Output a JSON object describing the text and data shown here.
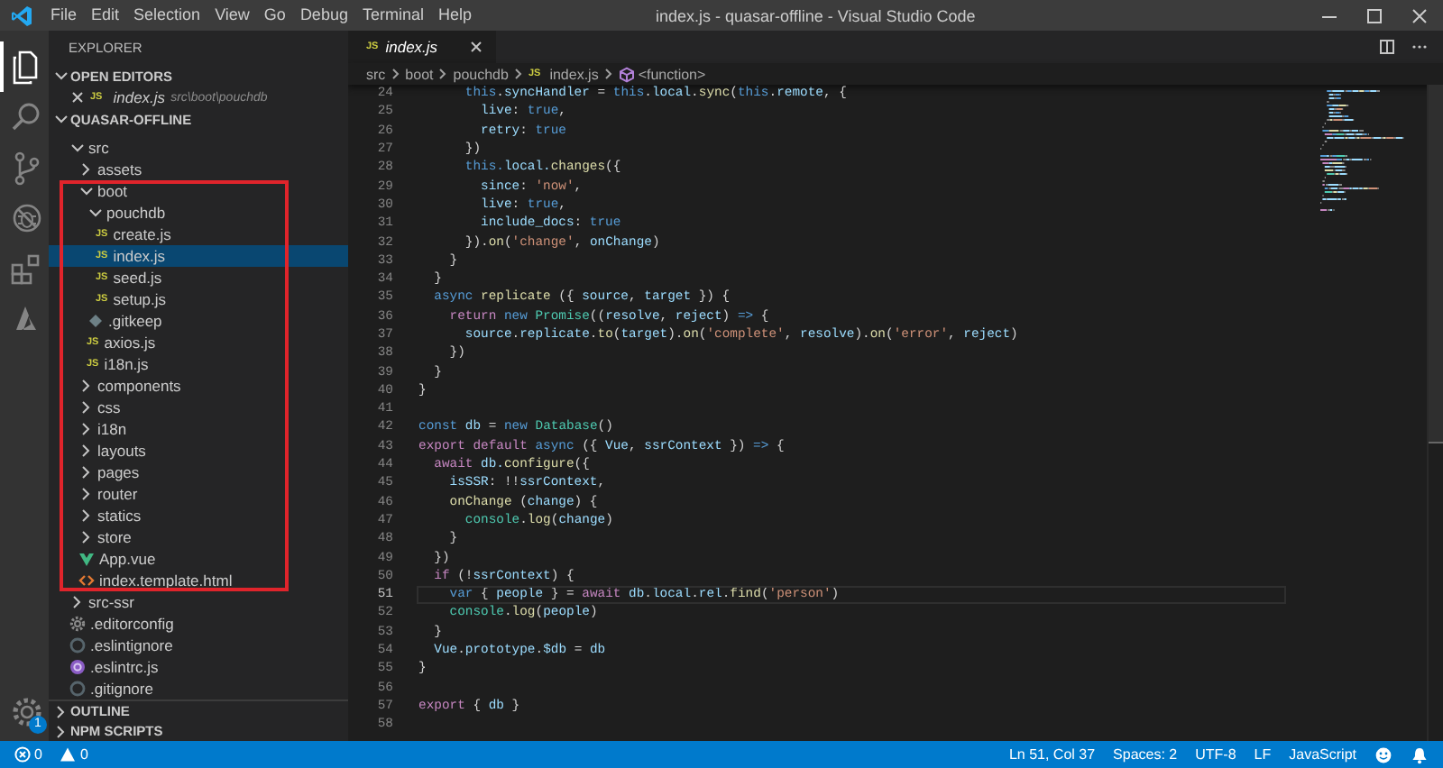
{
  "window": {
    "title": "index.js - quasar-offline - Visual Studio Code"
  },
  "menu": [
    "File",
    "Edit",
    "Selection",
    "View",
    "Go",
    "Debug",
    "Terminal",
    "Help"
  ],
  "activity_bar": {
    "items": [
      {
        "kind": "files",
        "selected": true
      },
      {
        "kind": "search",
        "selected": false
      },
      {
        "kind": "source-control",
        "selected": false
      },
      {
        "kind": "debug",
        "selected": false
      },
      {
        "kind": "extensions",
        "selected": false
      },
      {
        "kind": "azure",
        "selected": false
      }
    ],
    "settings_badge": "1"
  },
  "sidebar": {
    "title": "EXPLORER",
    "open_editors": {
      "title": "OPEN EDITORS",
      "expanded": true,
      "items": [
        {
          "badge": "JS",
          "name": "index.js",
          "path": "src\\boot\\pouchdb"
        }
      ]
    },
    "folder": {
      "title": "QUASAR-OFFLINE",
      "expanded": true
    },
    "tree": [
      {
        "label": "src",
        "kind": "folder",
        "expanded": true,
        "selected": false,
        "framed": false,
        "children": [
          {
            "label": "assets",
            "kind": "folder",
            "expanded": false,
            "selected": false,
            "framed": false
          },
          {
            "label": "boot",
            "kind": "folder",
            "expanded": true,
            "selected": false,
            "framed": true,
            "children": [
              {
                "label": "pouchdb",
                "kind": "folder",
                "expanded": true,
                "selected": false,
                "framed": true,
                "children": [
                  {
                    "label": "create.js",
                    "kind": "js",
                    "badge": "JS",
                    "selected": false,
                    "framed": true
                  },
                  {
                    "label": "index.js",
                    "kind": "js",
                    "badge": "JS",
                    "selected": true,
                    "framed": true
                  },
                  {
                    "label": "seed.js",
                    "kind": "js",
                    "badge": "JS",
                    "selected": false,
                    "framed": true
                  },
                  {
                    "label": "setup.js",
                    "kind": "js",
                    "badge": "JS",
                    "selected": false,
                    "framed": true
                  }
                ]
              },
              {
                "label": ".gitkeep",
                "kind": "gitkeep",
                "selected": false,
                "framed": true
              },
              {
                "label": "axios.js",
                "kind": "js",
                "badge": "JS",
                "selected": false,
                "framed": true
              },
              {
                "label": "i18n.js",
                "kind": "js",
                "badge": "JS",
                "selected": false,
                "framed": true
              }
            ]
          },
          {
            "label": "components",
            "kind": "folder",
            "expanded": false,
            "selected": false,
            "framed": true
          },
          {
            "label": "css",
            "kind": "folder",
            "expanded": false,
            "selected": false,
            "framed": true
          },
          {
            "label": "i18n",
            "kind": "folder",
            "expanded": false,
            "selected": false,
            "framed": true
          },
          {
            "label": "layouts",
            "kind": "folder",
            "expanded": false,
            "selected": false,
            "framed": true
          },
          {
            "label": "pages",
            "kind": "folder",
            "expanded": false,
            "selected": false,
            "framed": true
          },
          {
            "label": "router",
            "kind": "folder",
            "expanded": false,
            "selected": false,
            "framed": true
          },
          {
            "label": "statics",
            "kind": "folder",
            "expanded": false,
            "selected": false,
            "framed": true
          },
          {
            "label": "store",
            "kind": "folder",
            "expanded": false,
            "selected": false,
            "framed": true
          },
          {
            "label": "App.vue",
            "kind": "vue",
            "selected": false,
            "framed": true
          },
          {
            "label": "index.template.html",
            "kind": "html",
            "selected": false,
            "framed": true
          }
        ]
      },
      {
        "label": "src-ssr",
        "kind": "folder",
        "expanded": false,
        "selected": false,
        "framed": false
      },
      {
        "label": ".editorconfig",
        "kind": "config",
        "selected": false,
        "framed": false
      },
      {
        "label": ".eslintignore",
        "kind": "ignore",
        "selected": false,
        "framed": false
      },
      {
        "label": ".eslintrc.js",
        "kind": "eslint",
        "selected": false,
        "framed": false
      },
      {
        "label": ".gitignore",
        "kind": "ignore",
        "selected": false,
        "framed": false
      }
    ],
    "panels": [
      {
        "title": "OUTLINE",
        "expanded": false
      },
      {
        "title": "NPM SCRIPTS",
        "expanded": false
      }
    ]
  },
  "tabs": [
    {
      "badge": "JS",
      "label": "index.js",
      "selected": true
    }
  ],
  "breadcrumb": [
    {
      "text": "src"
    },
    {
      "text": "boot"
    },
    {
      "text": "pouchdb"
    },
    {
      "text": "index.js",
      "badge": "JS"
    },
    {
      "text": "<function>",
      "kind": "symbol"
    }
  ],
  "code": [
    {
      "number": "24",
      "current": false,
      "tokens": [
        {
          "kind": "keyword",
          "text": "      this"
        },
        {
          "kind": "plain",
          "text": "."
        },
        {
          "kind": "variable",
          "text": "syncHandler"
        },
        {
          "kind": "plain",
          "text": " = "
        },
        {
          "kind": "keyword",
          "text": "this"
        },
        {
          "kind": "plain",
          "text": "."
        },
        {
          "kind": "variable",
          "text": "local"
        },
        {
          "kind": "plain",
          "text": "."
        },
        {
          "kind": "function",
          "text": "sync"
        },
        {
          "kind": "plain",
          "text": "("
        },
        {
          "kind": "keyword",
          "text": "this"
        },
        {
          "kind": "plain",
          "text": "."
        },
        {
          "kind": "variable",
          "text": "remote"
        },
        {
          "kind": "plain",
          "text": ", {"
        }
      ]
    },
    {
      "number": "25",
      "current": false,
      "tokens": [
        {
          "kind": "variable",
          "text": "        live"
        },
        {
          "kind": "plain",
          "text": ": "
        },
        {
          "kind": "keyword",
          "text": "true"
        },
        {
          "kind": "plain",
          "text": ","
        }
      ]
    },
    {
      "number": "26",
      "current": false,
      "tokens": [
        {
          "kind": "variable",
          "text": "        retry"
        },
        {
          "kind": "plain",
          "text": ": "
        },
        {
          "kind": "keyword",
          "text": "true"
        }
      ]
    },
    {
      "number": "27",
      "current": false,
      "tokens": [
        {
          "kind": "plain",
          "text": "      })"
        }
      ]
    },
    {
      "number": "28",
      "current": false,
      "tokens": [
        {
          "kind": "keyword",
          "text": "      this."
        },
        {
          "kind": "variable",
          "text": "local."
        },
        {
          "kind": "function",
          "text": "changes"
        },
        {
          "kind": "plain",
          "text": "({"
        }
      ]
    },
    {
      "number": "29",
      "current": false,
      "tokens": [
        {
          "kind": "variable",
          "text": "        since"
        },
        {
          "kind": "plain",
          "text": ": "
        },
        {
          "kind": "string",
          "text": "'now'"
        },
        {
          "kind": "plain",
          "text": ","
        }
      ]
    },
    {
      "number": "30",
      "current": false,
      "tokens": [
        {
          "kind": "variable",
          "text": "        live"
        },
        {
          "kind": "plain",
          "text": ": "
        },
        {
          "kind": "keyword",
          "text": "true"
        },
        {
          "kind": "plain",
          "text": ","
        }
      ]
    },
    {
      "number": "31",
      "current": false,
      "tokens": [
        {
          "kind": "variable",
          "text": "        include_docs"
        },
        {
          "kind": "plain",
          "text": ": "
        },
        {
          "kind": "keyword",
          "text": "true"
        }
      ]
    },
    {
      "number": "32",
      "current": false,
      "tokens": [
        {
          "kind": "plain",
          "text": "      })."
        },
        {
          "kind": "function",
          "text": "on"
        },
        {
          "kind": "plain",
          "text": "("
        },
        {
          "kind": "string",
          "text": "'change'"
        },
        {
          "kind": "plain",
          "text": ", "
        },
        {
          "kind": "variable",
          "text": "onChange"
        },
        {
          "kind": "plain",
          "text": ")"
        }
      ]
    },
    {
      "number": "33",
      "current": false,
      "tokens": [
        {
          "kind": "plain",
          "text": "    }"
        }
      ]
    },
    {
      "number": "34",
      "current": false,
      "tokens": [
        {
          "kind": "plain",
          "text": "  }"
        }
      ]
    },
    {
      "number": "35",
      "current": false,
      "tokens": [
        {
          "kind": "keyword",
          "text": "  async "
        },
        {
          "kind": "function",
          "text": "replicate"
        },
        {
          "kind": "plain",
          "text": " ({ "
        },
        {
          "kind": "variable",
          "text": "source"
        },
        {
          "kind": "plain",
          "text": ", "
        },
        {
          "kind": "variable",
          "text": "target"
        },
        {
          "kind": "plain",
          "text": " }) {"
        }
      ]
    },
    {
      "number": "36",
      "current": false,
      "tokens": [
        {
          "kind": "control",
          "text": "    return "
        },
        {
          "kind": "keyword",
          "text": "new "
        },
        {
          "kind": "type",
          "text": "Promise"
        },
        {
          "kind": "plain",
          "text": "(("
        },
        {
          "kind": "variable",
          "text": "resolve"
        },
        {
          "kind": "plain",
          "text": ", "
        },
        {
          "kind": "variable",
          "text": "reject"
        },
        {
          "kind": "plain",
          "text": ") "
        },
        {
          "kind": "keyword",
          "text": "=>"
        },
        {
          "kind": "plain",
          "text": " {"
        }
      ]
    },
    {
      "number": "37",
      "current": false,
      "tokens": [
        {
          "kind": "variable",
          "text": "      source"
        },
        {
          "kind": "plain",
          "text": "."
        },
        {
          "kind": "variable",
          "text": "replicate"
        },
        {
          "kind": "plain",
          "text": "."
        },
        {
          "kind": "function",
          "text": "to"
        },
        {
          "kind": "plain",
          "text": "("
        },
        {
          "kind": "variable",
          "text": "target"
        },
        {
          "kind": "plain",
          "text": ")."
        },
        {
          "kind": "function",
          "text": "on"
        },
        {
          "kind": "plain",
          "text": "("
        },
        {
          "kind": "string",
          "text": "'complete'"
        },
        {
          "kind": "plain",
          "text": ", "
        },
        {
          "kind": "variable",
          "text": "resolve"
        },
        {
          "kind": "plain",
          "text": ")."
        },
        {
          "kind": "function",
          "text": "on"
        },
        {
          "kind": "plain",
          "text": "("
        },
        {
          "kind": "string",
          "text": "'error'"
        },
        {
          "kind": "plain",
          "text": ", "
        },
        {
          "kind": "variable",
          "text": "reject"
        },
        {
          "kind": "plain",
          "text": ")"
        }
      ]
    },
    {
      "number": "38",
      "current": false,
      "tokens": [
        {
          "kind": "plain",
          "text": "    })"
        }
      ]
    },
    {
      "number": "39",
      "current": false,
      "tokens": [
        {
          "kind": "plain",
          "text": "  }"
        }
      ]
    },
    {
      "number": "40",
      "current": false,
      "tokens": [
        {
          "kind": "plain",
          "text": "}"
        }
      ]
    },
    {
      "number": "41",
      "current": false
    },
    {
      "number": "42",
      "current": false,
      "tokens": [
        {
          "kind": "keyword",
          "text": "const "
        },
        {
          "kind": "variable",
          "text": "db"
        },
        {
          "kind": "plain",
          "text": " = "
        },
        {
          "kind": "keyword",
          "text": "new "
        },
        {
          "kind": "type",
          "text": "Database"
        },
        {
          "kind": "plain",
          "text": "()"
        }
      ]
    },
    {
      "number": "43",
      "current": false,
      "tokens": [
        {
          "kind": "control",
          "text": "export default "
        },
        {
          "kind": "keyword",
          "text": "async"
        },
        {
          "kind": "plain",
          "text": " ({ "
        },
        {
          "kind": "variable",
          "text": "Vue"
        },
        {
          "kind": "plain",
          "text": ", "
        },
        {
          "kind": "variable",
          "text": "ssrContext"
        },
        {
          "kind": "plain",
          "text": " }) "
        },
        {
          "kind": "keyword",
          "text": "=>"
        },
        {
          "kind": "plain",
          "text": " {"
        }
      ]
    },
    {
      "number": "44",
      "current": false,
      "tokens": [
        {
          "kind": "control",
          "text": "  await "
        },
        {
          "kind": "variable",
          "text": "db."
        },
        {
          "kind": "function",
          "text": "configure"
        },
        {
          "kind": "plain",
          "text": "({"
        }
      ]
    },
    {
      "number": "45",
      "current": false,
      "tokens": [
        {
          "kind": "variable",
          "text": "    isSSR"
        },
        {
          "kind": "plain",
          "text": ": !!"
        },
        {
          "kind": "variable",
          "text": "ssrContext"
        },
        {
          "kind": "plain",
          "text": ","
        }
      ]
    },
    {
      "number": "46",
      "current": false,
      "tokens": [
        {
          "kind": "function",
          "text": "    onChange"
        },
        {
          "kind": "plain",
          "text": " ("
        },
        {
          "kind": "variable",
          "text": "change"
        },
        {
          "kind": "plain",
          "text": ") {"
        }
      ]
    },
    {
      "number": "47",
      "current": false,
      "tokens": [
        {
          "kind": "type",
          "text": "      console"
        },
        {
          "kind": "plain",
          "text": "."
        },
        {
          "kind": "function",
          "text": "log"
        },
        {
          "kind": "plain",
          "text": "("
        },
        {
          "kind": "variable",
          "text": "change"
        },
        {
          "kind": "plain",
          "text": ")"
        }
      ]
    },
    {
      "number": "48",
      "current": false,
      "tokens": [
        {
          "kind": "plain",
          "text": "    }"
        }
      ]
    },
    {
      "number": "49",
      "current": false,
      "tokens": [
        {
          "kind": "plain",
          "text": "  })"
        }
      ]
    },
    {
      "number": "50",
      "current": false,
      "tokens": [
        {
          "kind": "control",
          "text": "  if"
        },
        {
          "kind": "plain",
          "text": " (!"
        },
        {
          "kind": "variable",
          "text": "ssrContext"
        },
        {
          "kind": "plain",
          "text": ") {"
        }
      ]
    },
    {
      "number": "51",
      "current": true,
      "tokens": [
        {
          "kind": "keyword",
          "text": "    var"
        },
        {
          "kind": "plain",
          "text": " { "
        },
        {
          "kind": "variable",
          "text": "people"
        },
        {
          "kind": "plain",
          "text": " } = "
        },
        {
          "kind": "control",
          "text": "await "
        },
        {
          "kind": "variable",
          "text": "db"
        },
        {
          "kind": "plain",
          "text": "."
        },
        {
          "kind": "variable",
          "text": "local"
        },
        {
          "kind": "plain",
          "text": "."
        },
        {
          "kind": "variable",
          "text": "rel"
        },
        {
          "kind": "plain",
          "text": "."
        },
        {
          "kind": "function",
          "text": "find"
        },
        {
          "kind": "plain",
          "text": "("
        },
        {
          "kind": "string",
          "text": "'person'"
        },
        {
          "kind": "plain",
          "text": ")"
        }
      ]
    },
    {
      "number": "52",
      "current": false,
      "tokens": [
        {
          "kind": "type",
          "text": "    console"
        },
        {
          "kind": "plain",
          "text": "."
        },
        {
          "kind": "function",
          "text": "log"
        },
        {
          "kind": "plain",
          "text": "("
        },
        {
          "kind": "variable",
          "text": "people"
        },
        {
          "kind": "plain",
          "text": ")"
        }
      ]
    },
    {
      "number": "53",
      "current": false,
      "tokens": [
        {
          "kind": "plain",
          "text": "  }"
        }
      ]
    },
    {
      "number": "54",
      "current": false,
      "tokens": [
        {
          "kind": "variable",
          "text": "  Vue"
        },
        {
          "kind": "plain",
          "text": "."
        },
        {
          "kind": "variable",
          "text": "prototype"
        },
        {
          "kind": "plain",
          "text": "."
        },
        {
          "kind": "variable",
          "text": "$db"
        },
        {
          "kind": "plain",
          "text": " = "
        },
        {
          "kind": "variable",
          "text": "db"
        }
      ]
    },
    {
      "number": "55",
      "current": false,
      "tokens": [
        {
          "kind": "plain",
          "text": "}"
        }
      ]
    },
    {
      "number": "56",
      "current": false
    },
    {
      "number": "57",
      "current": false,
      "tokens": [
        {
          "kind": "control",
          "text": "export"
        },
        {
          "kind": "plain",
          "text": " { "
        },
        {
          "kind": "variable",
          "text": "db"
        },
        {
          "kind": "plain",
          "text": " }"
        }
      ]
    },
    {
      "number": "58",
      "current": false
    }
  ],
  "status_bar": {
    "problems": [
      {
        "kind": "error",
        "count": "0"
      },
      {
        "kind": "warning",
        "count": "0"
      }
    ],
    "items": [
      "Ln 51, Col 37",
      "Spaces: 2",
      "UTF-8",
      "LF",
      "JavaScript"
    ]
  }
}
